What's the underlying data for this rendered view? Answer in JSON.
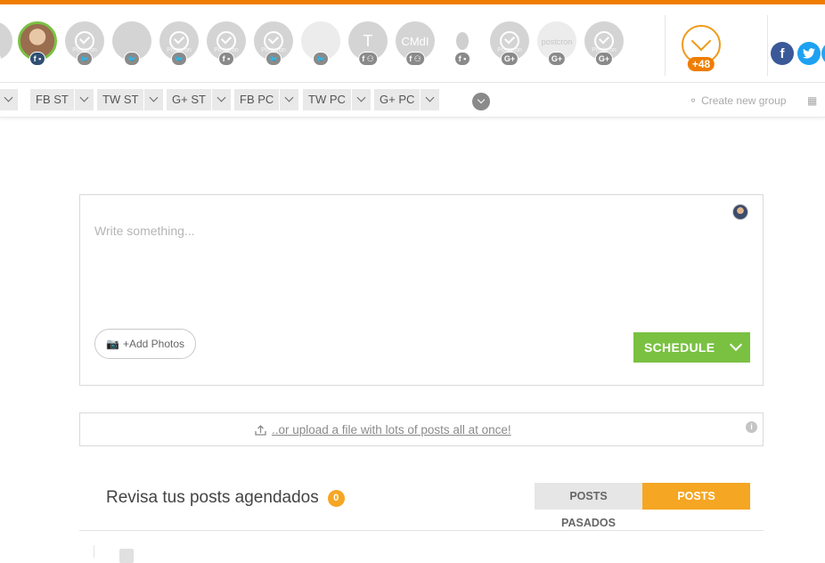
{
  "accounts": [
    {
      "initial": "",
      "network": "twitter",
      "badge": "twitter-badge",
      "style": "gray"
    },
    {
      "initial": "",
      "network": "facebook-page",
      "badge": "f ▪",
      "style": "selected"
    },
    {
      "initial": "",
      "network": "twitter",
      "badge": "twitter-badge",
      "style": "logo",
      "watermark": "Postcron"
    },
    {
      "initial": "",
      "network": "twitter",
      "badge": "twitter-badge",
      "style": "photo"
    },
    {
      "initial": "",
      "network": "twitter",
      "badge": "twitter-badge",
      "style": "logo",
      "watermark": "Postcron"
    },
    {
      "initial": "",
      "network": "facebook-page",
      "badge": "f ▪",
      "style": "logo",
      "watermark": "Postcron"
    },
    {
      "initial": "",
      "network": "twitter",
      "badge": "twitter-badge",
      "style": "logo",
      "watermark": "Postcron"
    },
    {
      "initial": "",
      "network": "twitter",
      "badge": "twitter-badge",
      "style": "blank"
    },
    {
      "initial": "T",
      "network": "facebook-group",
      "badge": "f ⚇",
      "style": "gray"
    },
    {
      "initial": "CMdI",
      "network": "facebook-group",
      "badge": "f ⚇",
      "style": "gray"
    },
    {
      "initial": "",
      "network": "facebook-page",
      "badge": "f ▪",
      "style": "balloon"
    },
    {
      "initial": "",
      "network": "google-plus",
      "badge": "G+",
      "style": "logo",
      "watermark": "Postcron"
    },
    {
      "initial": "",
      "network": "google-plus",
      "badge": "G+",
      "style": "light",
      "watermark": "postcron"
    },
    {
      "initial": "",
      "network": "google-plus",
      "badge": "G+",
      "style": "logo",
      "watermark": "Postcron"
    }
  ],
  "more_accounts": "+48",
  "groups": [
    {
      "label": ""
    },
    {
      "label": "FB ST"
    },
    {
      "label": "TW ST"
    },
    {
      "label": "G+ ST"
    },
    {
      "label": "FB PC"
    },
    {
      "label": "TW PC"
    },
    {
      "label": "G+ PC"
    }
  ],
  "create_group": "Create new group",
  "composer": {
    "placeholder": "Write something...",
    "add_photos": "+Add Photos",
    "schedule": "SCHEDULE"
  },
  "upload": {
    "text": "..or upload a file with lots of posts all at once!",
    "info": "i"
  },
  "posts": {
    "title": "Revisa tus posts agendados",
    "count": "0",
    "tab_past": "POSTS PASADOS",
    "tab_future": "POSTS FUTUROS"
  },
  "colors": {
    "brand": "#ef7d00",
    "schedule_green": "#7ac142",
    "tab_active": "#f5a623"
  }
}
